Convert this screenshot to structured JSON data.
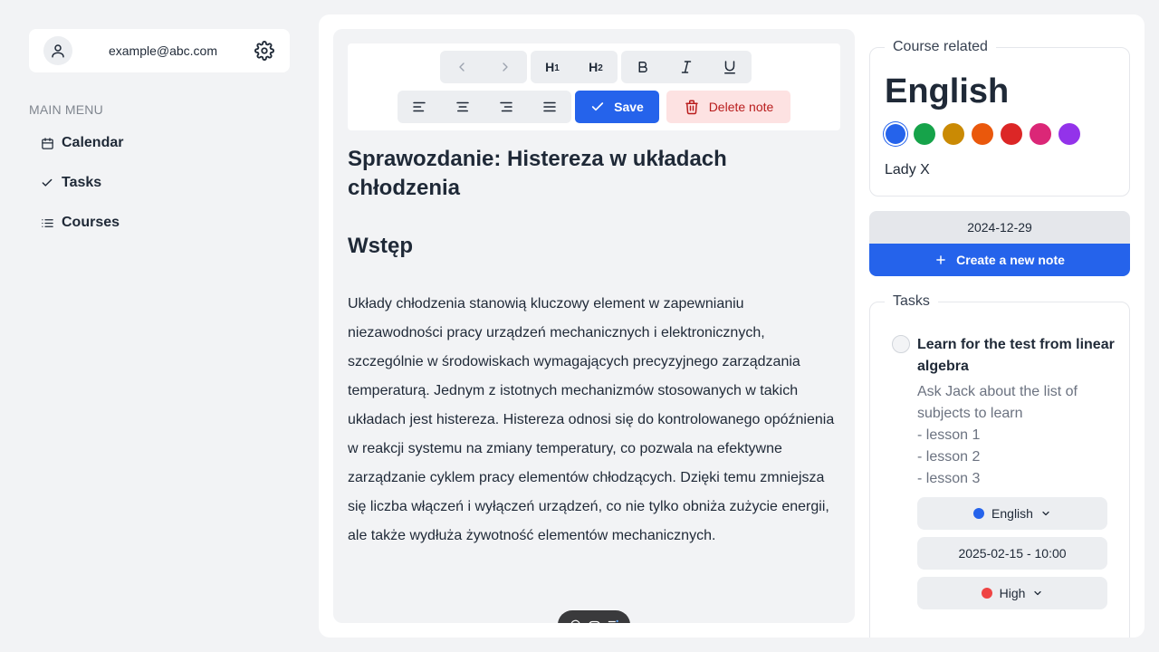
{
  "user": {
    "email": "example@abc.com"
  },
  "menu": {
    "title": "MAIN MENU",
    "items": [
      {
        "label": "Calendar",
        "icon": "calendar-icon"
      },
      {
        "label": "Tasks",
        "icon": "check-icon"
      },
      {
        "label": "Courses",
        "icon": "list-icon"
      }
    ]
  },
  "toolbar": {
    "h1_label": "H",
    "h1_sub": "1",
    "h2_label": "H",
    "h2_sub": "2",
    "save_label": "Save",
    "delete_label": "Delete note"
  },
  "note": {
    "title": "Sprawozdanie: Histereza w układach chłodzenia",
    "heading": "Wstęp",
    "paragraph": "Układy chłodzenia stanowią kluczowy element w zapewnianiu niezawodności pracy urządzeń mechanicznych i elektronicznych, szczególnie w środowiskach wymagających precyzyjnego zarządzania temperaturą. Jednym z istotnych mechanizmów stosowanych w takich układach jest histereza. Histereza odnosi się do kontrolowanego opóźnienia w reakcji systemu na zmiany temperatury, co pozwala na efektywne zarządzanie cyklem pracy elementów chłodzących. Dzięki temu zmniejsza się liczba włączeń i wyłączeń urządzeń, co nie tylko obniża zużycie energii, ale także wydłuża żywotność elementów mechanicznych."
  },
  "course": {
    "legend": "Course related",
    "name": "English",
    "teacher": "Lady X",
    "colors": [
      "#2563eb",
      "#16a34a",
      "#ca8a04",
      "#ea580c",
      "#dc2626",
      "#db2777",
      "#9333ea"
    ],
    "selected_color": "#2563eb"
  },
  "date": "2024-12-29",
  "create_note_label": "Create a new note",
  "tasks": {
    "legend": "Tasks",
    "items": [
      {
        "title": "Learn for the test from linear algebra",
        "description": "Ask Jack about the list of subjects to learn\n- lesson 1\n- lesson 2\n- lesson 3",
        "course": "English",
        "course_color": "#2563eb",
        "due": "2025-02-15 - 10:00",
        "priority": "High",
        "priority_color": "#ef4444"
      }
    ]
  }
}
